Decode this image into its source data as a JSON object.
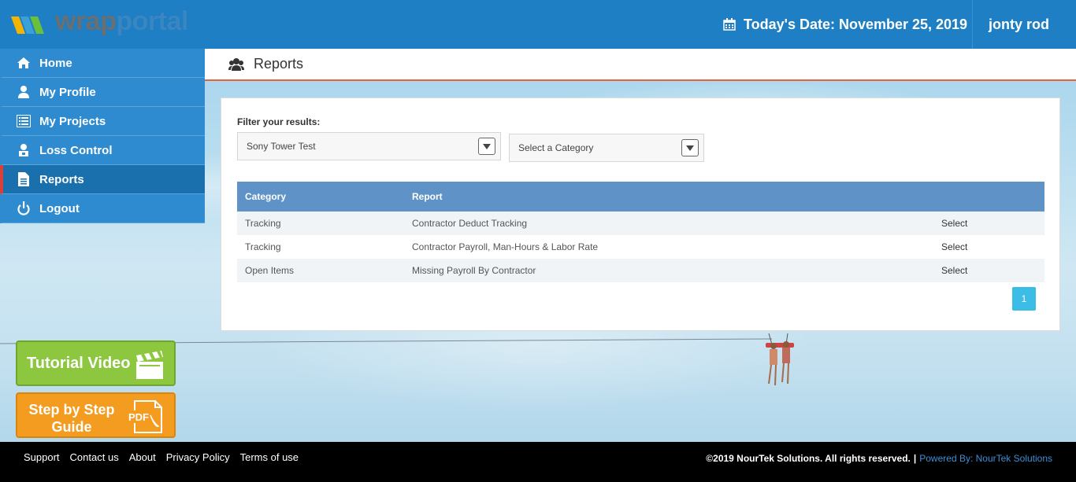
{
  "header": {
    "logo_text_1": "wrap",
    "logo_text_2": "portal",
    "date_text": "Today's Date: November 25, 2019",
    "user_name": "jonty rod"
  },
  "sidebar": {
    "items": [
      {
        "label": "Home",
        "icon": "home-icon"
      },
      {
        "label": "My Profile",
        "icon": "user-icon"
      },
      {
        "label": "My Projects",
        "icon": "list-icon"
      },
      {
        "label": "Loss Control",
        "icon": "person-badge-icon"
      },
      {
        "label": "Reports",
        "icon": "document-icon",
        "active": true
      },
      {
        "label": "Logout",
        "icon": "power-icon"
      }
    ]
  },
  "page": {
    "title": "Reports"
  },
  "filter": {
    "label": "Filter your results:",
    "project_value": "Sony Tower Test",
    "category_placeholder": "Select a Category"
  },
  "table": {
    "headers": [
      "Category",
      "Report",
      ""
    ],
    "rows": [
      {
        "category": "Tracking",
        "report": "Contractor Deduct Tracking",
        "action": "Select"
      },
      {
        "category": "Tracking",
        "report": "Contractor Payroll, Man-Hours & Labor Rate",
        "action": "Select"
      },
      {
        "category": "Open Items",
        "report": "Missing Payroll By Contractor",
        "action": "Select"
      }
    ]
  },
  "pagination": {
    "current_page": "1"
  },
  "buttons": {
    "tutorial_label": "Tutorial Video",
    "guide_label": "Step by Step Guide",
    "pdf_label": "PDF"
  },
  "footer": {
    "links": [
      "Support",
      "Contact us",
      "About",
      "Privacy Policy",
      "Terms of use"
    ],
    "copyright": "©2019 NourTek Solutions. All rights reserved.",
    "separator": "|",
    "powered": "Powered By: NourTek Solutions"
  },
  "colors": {
    "header_bg": "#1f7fc4",
    "sidebar_bg": "#2f8bd0",
    "active_accent": "#d9403a",
    "table_header_bg": "#5f93c8",
    "pager_bg": "#3bbde6",
    "tutorial_bg": "#8dc63f",
    "guide_bg": "#f39c1f"
  }
}
